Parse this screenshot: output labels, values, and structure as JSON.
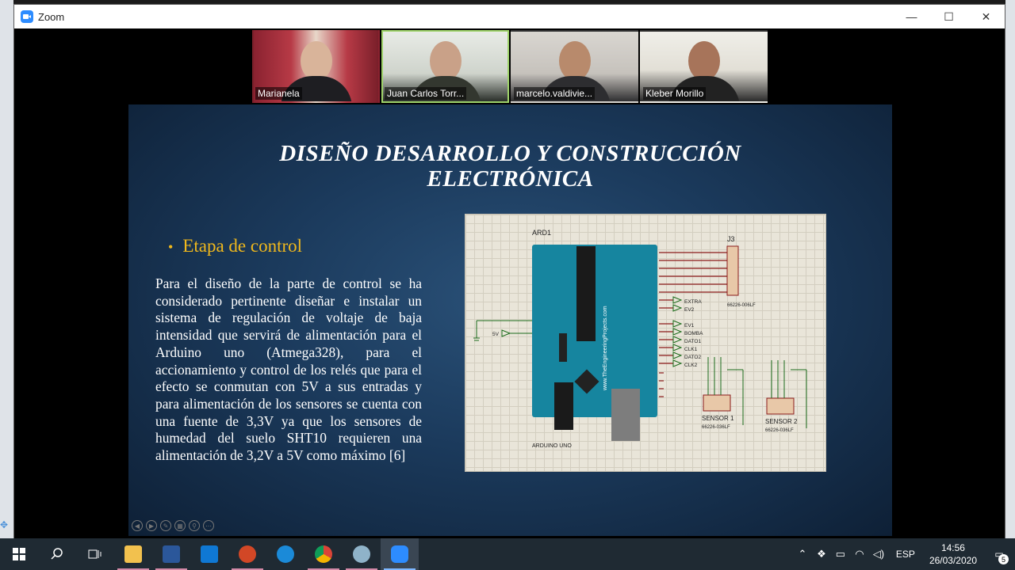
{
  "window": {
    "title": "Zoom",
    "minimize": "—",
    "maximize": "☐",
    "close": "✕"
  },
  "participants": [
    {
      "name": "Marianela"
    },
    {
      "name": "Juan Carlos Torr..."
    },
    {
      "name": "marcelo.valdivie..."
    },
    {
      "name": "Kleber Morillo"
    }
  ],
  "slide": {
    "title_line1": "DISEÑO DESARROLLO Y CONSTRUCCIÓN",
    "title_line2": "ELECTRÓNICA",
    "bullet": "Etapa de control",
    "body": "Para el diseño de la parte de control se ha considerado pertinente diseñar e instalar un sistema de regulación de voltaje de baja intensidad que servirá de alimentación para el Arduino uno (Atmega328), para el accionamiento y control de los relés que para el efecto se conmutan con 5V a sus entradas y para alimentación de los sensores se cuenta con una fuente de 3,3V ya que los sensores de humedad del suelo SHT10 requieren una alimentación de 3,2V a 5V como máximo [6]",
    "schematic": {
      "ard_label": "ARD1",
      "board_label": "ARDUINO UNO",
      "j3_label": "J3",
      "j3_part": "66226-006LF",
      "sensor1": "SENSOR 1",
      "sensor1_part": "66226-036LF",
      "sensor2": "SENSOR 2",
      "sensor2_part": "66226-036LF",
      "website": "www.TheEngineeringProjects.com",
      "v5": "5V",
      "outputs": [
        "EXTRA",
        "EV2",
        "EV1",
        "BOMBA",
        "DATO1",
        "CLK1",
        "DATO2",
        "CLK2"
      ]
    }
  },
  "taskbar": {
    "language": "ESP",
    "time": "14:56",
    "date": "26/03/2020",
    "notifications": "5"
  }
}
